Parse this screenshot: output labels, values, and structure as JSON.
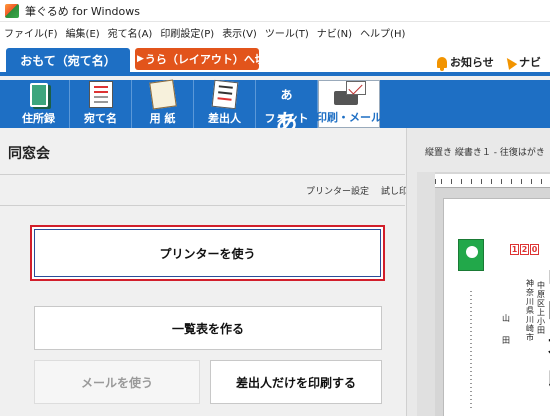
{
  "window": {
    "title": "筆ぐるめ for Windows"
  },
  "menu": [
    "ファイル(F)",
    "編集(E)",
    "宛て名(A)",
    "印刷設定(P)",
    "表示(V)",
    "ツール(T)",
    "ナビ(N)",
    "ヘルプ(H)"
  ],
  "mode_tabs": {
    "front": "おもて（宛て名）",
    "back": "うら（レイアウト）へ切替",
    "notice": "お知らせ",
    "navi": "ナビ"
  },
  "toolbar": [
    {
      "label": "住所録",
      "icon": "address-book-icon"
    },
    {
      "label": "宛て名",
      "icon": "address-card-icon"
    },
    {
      "label": "用 紙",
      "icon": "paper-icon"
    },
    {
      "label": "差出人",
      "icon": "sender-icon"
    },
    {
      "label": "フォント",
      "icon": "font-icon"
    },
    {
      "label": "印刷・メール",
      "icon": "print-mail-icon",
      "active": true
    }
  ],
  "font_icon_text": {
    "small": "あ",
    "large": "あ"
  },
  "panel": {
    "title": "同窓会",
    "links": [
      "プリンター設定",
      "試し印刷"
    ],
    "buttons": {
      "use_printer": "プリンターを使う",
      "make_list": "一覧表を作る",
      "use_mail": "メールを使う",
      "print_sender_only": "差出人だけを印刷する"
    }
  },
  "preview": {
    "title": "縦置き 縦書き１ - 往復はがき",
    "postal_code": [
      "1",
      "2",
      "0"
    ],
    "recipient": [
      "山",
      "田",
      "太",
      "郎"
    ],
    "address_line1": "神奈川県川崎市",
    "address_line2": "中原区上小田",
    "sender": [
      "山",
      "田"
    ]
  },
  "colors": {
    "accent_blue": "#1e6fc4",
    "switch_orange": "#e2541b",
    "highlight_red": "#d21e2b"
  }
}
